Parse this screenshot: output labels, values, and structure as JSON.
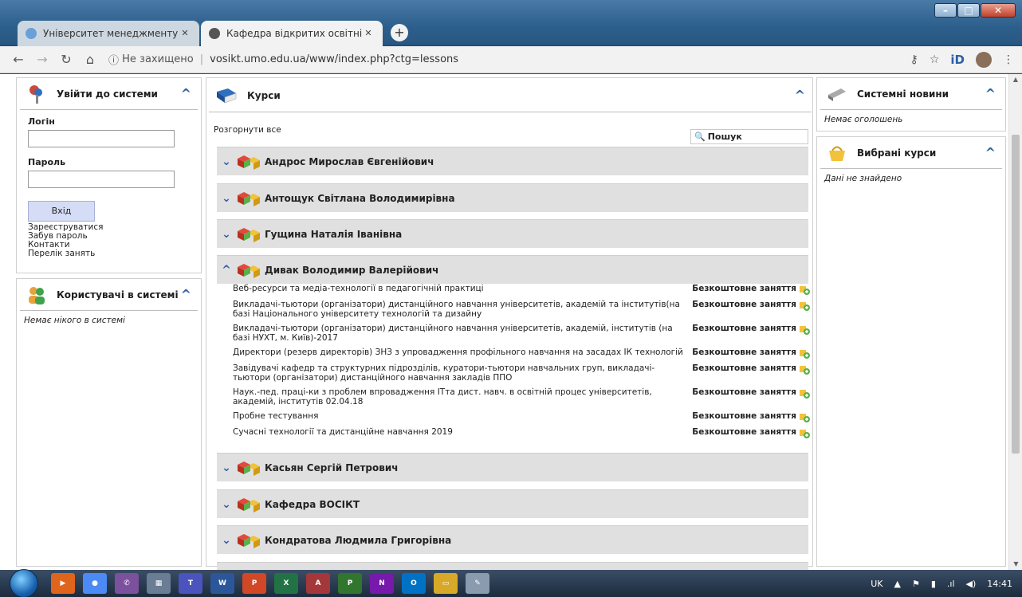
{
  "browser": {
    "tabs": [
      {
        "title": "Університет менеджменту освіт",
        "active": false
      },
      {
        "title": "Кафедра відкритих освітніх сист",
        "active": true
      }
    ],
    "security_label": "Не захищено",
    "url": "vosikt.umo.edu.ua/www/index.php?ctg=lessons"
  },
  "login": {
    "title": "Увійти до системи",
    "login_label": "Логін",
    "password_label": "Пароль",
    "button": "Вхід",
    "links": [
      "Зареєструватися",
      "Забув пароль",
      "Контакти",
      "Перелік занять"
    ]
  },
  "online_users": {
    "title": "Користувачі в системі",
    "empty": "Немає нікого в системі"
  },
  "courses": {
    "title": "Курси",
    "expand_all": "Розгорнути все",
    "search": "Пошук",
    "free_label": "Безкоштовне заняття",
    "teachers": [
      "Андрос Мирослав Євгенійович",
      "Антощук Світлана Володимирівна",
      "Гущина Наталія Іванівна",
      "Дивак Володимир Валерійович",
      "Касьян Сергій Петрович",
      "Кафедра ВОСІКТ",
      "Кондратова Людмила Григорівна"
    ],
    "lessons": [
      "Веб-ресурси та медіа-технології в педагогічній практиці",
      "Викладачі-тьютори (організатори) дистанційного навчання університетів, академій та інститутів(на базі Національного університету технологій та дизайну",
      "Викладачі-тьютори (організатори) дистанційного навчання університетів, академій, інститутів (на базі НУХТ, м. Київ)-2017",
      "Директори (резерв директорів) ЗНЗ з упровадження профільного навчання на засадах ІК технологій",
      "Завідувачі кафедр та структурних підрозділів, куратори-тьютори навчальних груп, викладачі-тьютори (організатори) дистанційного навчання закладів ППО",
      "Наук.-пед. праці-ки з проблем впровадження ІТта дист. навч. в освітній процес університетів, академій, інститутів 02.04.18",
      "Пробне тестування",
      "Сучасні технології та дистанційне навчання 2019"
    ]
  },
  "news": {
    "title": "Системні новини",
    "empty": "Немає оголошень"
  },
  "favorites": {
    "title": "Вибрані курси",
    "empty": "Дані не знайдено"
  },
  "taskbar": {
    "lang": "UK",
    "time": "14:41"
  }
}
